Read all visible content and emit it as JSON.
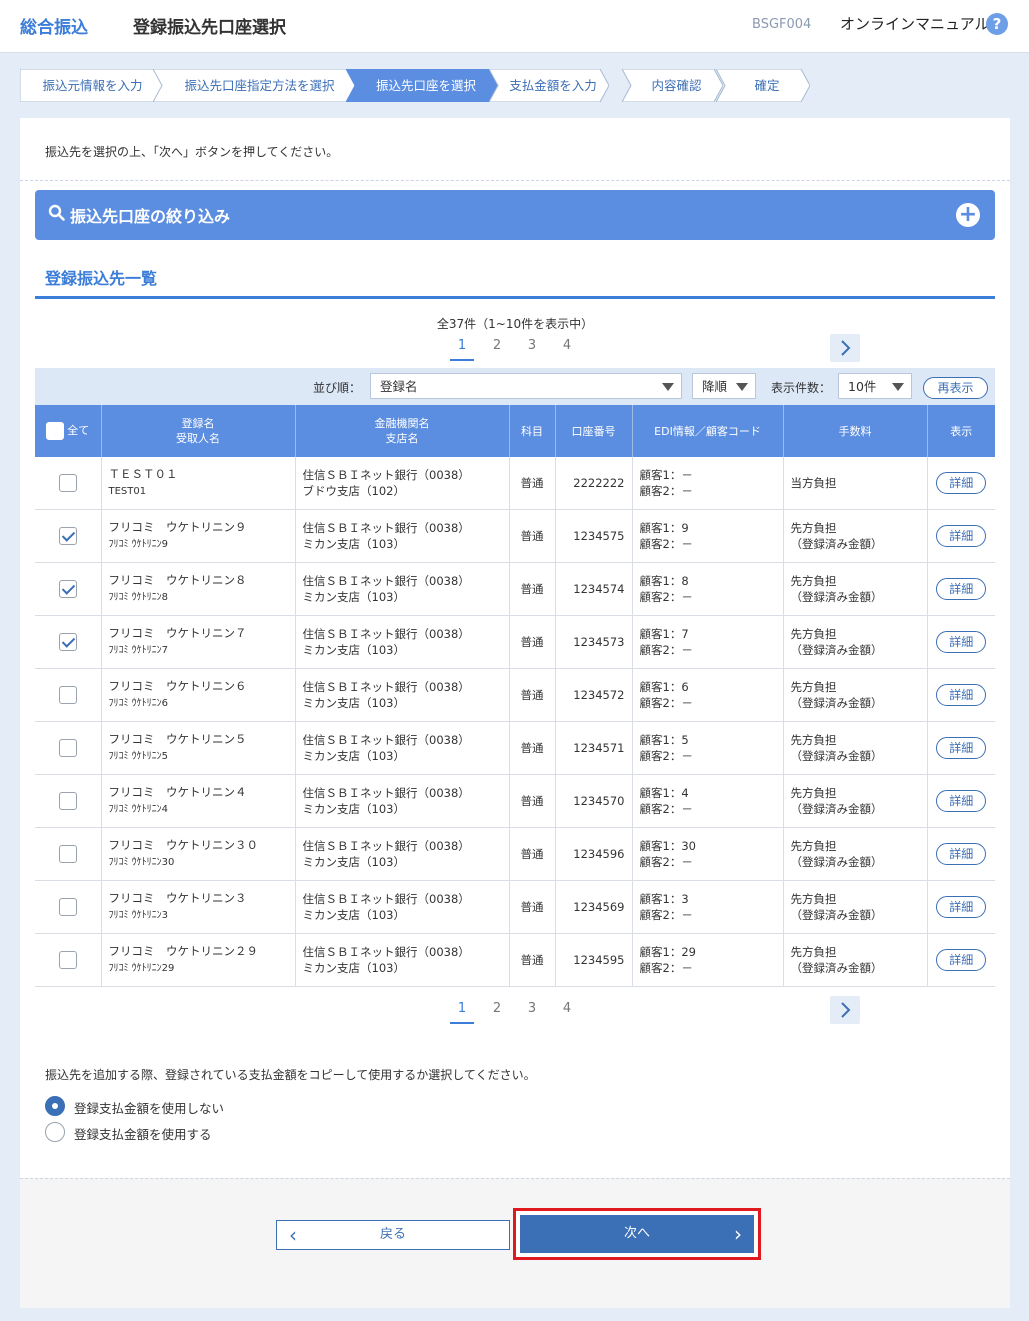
{
  "header": {
    "app_title": "総合振込",
    "page_title": "登録振込先口座選択",
    "screen_id": "BSGF004",
    "manual_label": "オンラインマニュアル",
    "help_glyph": "?"
  },
  "steps": [
    {
      "label": "振込元情報を入力",
      "active": false
    },
    {
      "label": "振込先口座指定方法を選択",
      "active": false
    },
    {
      "label": "振込先口座を選択",
      "active": true
    },
    {
      "label": "支払金額を入力",
      "active": false
    },
    {
      "label": "内容確認",
      "active": false
    },
    {
      "label": "確定",
      "active": false
    }
  ],
  "instruction": "振込先を選択の上、「次へ」ボタンを押してください。",
  "filter": {
    "title": "振込先口座の絞り込み",
    "icon": "search-icon",
    "expand_icon": "plus-icon",
    "expand_glyph": "+"
  },
  "list": {
    "title": "登録振込先一覧",
    "total": "全37件（1~10件を表示中）",
    "pages": [
      "1",
      "2",
      "3",
      "4"
    ],
    "current_page": "1"
  },
  "sort": {
    "order_label": "並び順：",
    "order_value": "登録名",
    "direction_value": "降順",
    "count_label": "表示件数：",
    "count_value": "10件",
    "redisplay_label": "再表示"
  },
  "table": {
    "headers": {
      "all": "全て",
      "name1": "登録名",
      "name2": "受取人名",
      "bank1": "金融機関名",
      "bank2": "支店名",
      "type": "科目",
      "account": "口座番号",
      "edi": "EDI情報／顧客コード",
      "fee": "手数料",
      "show": "表示"
    },
    "detail_label": "詳細",
    "rows": [
      {
        "checked": false,
        "name": "ＴＥＳＴ０１",
        "kana": "TEST01",
        "bank": "住信ＳＢＩネット銀行（0038）",
        "branch": "ブドウ支店（102）",
        "type": "普通",
        "account": "2222222",
        "c1": "顧客1：－",
        "c2": "顧客2：－",
        "fee1": "当方負担",
        "fee2": ""
      },
      {
        "checked": true,
        "name": "フリコミ　ウケトリニン９",
        "kana": "ﾌﾘｺﾐ ｳｹﾄﾘﾆﾝ9",
        "bank": "住信ＳＢＩネット銀行（0038）",
        "branch": "ミカン支店（103）",
        "type": "普通",
        "account": "1234575",
        "c1": "顧客1：9",
        "c2": "顧客2：－",
        "fee1": "先方負担",
        "fee2": "（登録済み金額）"
      },
      {
        "checked": true,
        "name": "フリコミ　ウケトリニン８",
        "kana": "ﾌﾘｺﾐ ｳｹﾄﾘﾆﾝ8",
        "bank": "住信ＳＢＩネット銀行（0038）",
        "branch": "ミカン支店（103）",
        "type": "普通",
        "account": "1234574",
        "c1": "顧客1：8",
        "c2": "顧客2：－",
        "fee1": "先方負担",
        "fee2": "（登録済み金額）"
      },
      {
        "checked": true,
        "name": "フリコミ　ウケトリニン７",
        "kana": "ﾌﾘｺﾐ ｳｹﾄﾘﾆﾝ7",
        "bank": "住信ＳＢＩネット銀行（0038）",
        "branch": "ミカン支店（103）",
        "type": "普通",
        "account": "1234573",
        "c1": "顧客1：7",
        "c2": "顧客2：－",
        "fee1": "先方負担",
        "fee2": "（登録済み金額）"
      },
      {
        "checked": false,
        "name": "フリコミ　ウケトリニン６",
        "kana": "ﾌﾘｺﾐ ｳｹﾄﾘﾆﾝ6",
        "bank": "住信ＳＢＩネット銀行（0038）",
        "branch": "ミカン支店（103）",
        "type": "普通",
        "account": "1234572",
        "c1": "顧客1：6",
        "c2": "顧客2：－",
        "fee1": "先方負担",
        "fee2": "（登録済み金額）"
      },
      {
        "checked": false,
        "name": "フリコミ　ウケトリニン５",
        "kana": "ﾌﾘｺﾐ ｳｹﾄﾘﾆﾝ5",
        "bank": "住信ＳＢＩネット銀行（0038）",
        "branch": "ミカン支店（103）",
        "type": "普通",
        "account": "1234571",
        "c1": "顧客1：5",
        "c2": "顧客2：－",
        "fee1": "先方負担",
        "fee2": "（登録済み金額）"
      },
      {
        "checked": false,
        "name": "フリコミ　ウケトリニン４",
        "kana": "ﾌﾘｺﾐ ｳｹﾄﾘﾆﾝ4",
        "bank": "住信ＳＢＩネット銀行（0038）",
        "branch": "ミカン支店（103）",
        "type": "普通",
        "account": "1234570",
        "c1": "顧客1：4",
        "c2": "顧客2：－",
        "fee1": "先方負担",
        "fee2": "（登録済み金額）"
      },
      {
        "checked": false,
        "name": "フリコミ　ウケトリニン３０",
        "kana": "ﾌﾘｺﾐ ｳｹﾄﾘﾆﾝ30",
        "bank": "住信ＳＢＩネット銀行（0038）",
        "branch": "ミカン支店（103）",
        "type": "普通",
        "account": "1234596",
        "c1": "顧客1：30",
        "c2": "顧客2：－",
        "fee1": "先方負担",
        "fee2": "（登録済み金額）"
      },
      {
        "checked": false,
        "name": "フリコミ　ウケトリニン３",
        "kana": "ﾌﾘｺﾐ ｳｹﾄﾘﾆﾝ3",
        "bank": "住信ＳＢＩネット銀行（0038）",
        "branch": "ミカン支店（103）",
        "type": "普通",
        "account": "1234569",
        "c1": "顧客1：3",
        "c2": "顧客2：－",
        "fee1": "先方負担",
        "fee2": "（登録済み金額）"
      },
      {
        "checked": false,
        "name": "フリコミ　ウケトリニン２９",
        "kana": "ﾌﾘｺﾐ ｳｹﾄﾘﾆﾝ29",
        "bank": "住信ＳＢＩネット銀行（0038）",
        "branch": "ミカン支店（103）",
        "type": "普通",
        "account": "1234595",
        "c1": "顧客1：29",
        "c2": "顧客2：－",
        "fee1": "先方負担",
        "fee2": "（登録済み金額）"
      }
    ]
  },
  "copy_option": {
    "note": "振込先を追加する際、登録されている支払金額をコピーして使用するか選択してください。",
    "options": [
      {
        "label": "登録支払金額を使用しない",
        "selected": true
      },
      {
        "label": "登録支払金額を使用する",
        "selected": false
      }
    ]
  },
  "buttons": {
    "back_label": "戻る",
    "next_label": "次へ"
  },
  "colors": {
    "accent": "#3b7dd8",
    "header_blue": "#5b8de0",
    "highlight_red": "#e0191f"
  }
}
